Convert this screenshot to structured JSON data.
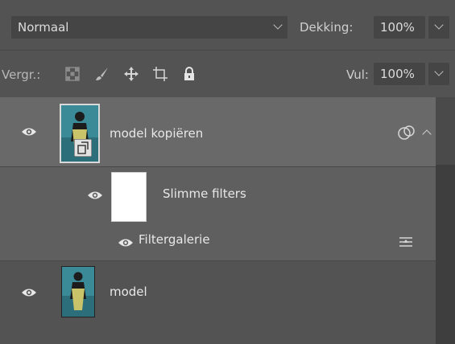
{
  "blend": {
    "mode": "Normaal",
    "opacity_label": "Dekking:",
    "opacity_value": "100%"
  },
  "locks": {
    "label": "Vergr.:",
    "icons": [
      "lock-transparent-pixels-icon",
      "lock-image-pixels-icon",
      "lock-position-icon",
      "lock-artboard-icon",
      "lock-all-icon"
    ],
    "fill_label": "Vul:",
    "fill_value": "100%"
  },
  "layers": [
    {
      "name": "model kopiëren",
      "visible": true,
      "selected": true,
      "smart_object": true,
      "expanded": true
    },
    {
      "name": "Slimme filters",
      "visible": true,
      "type": "smart-filter-mask"
    },
    {
      "name": "Filtergalerie",
      "visible": true,
      "type": "filter"
    },
    {
      "name": "model",
      "visible": true,
      "selected": false
    }
  ],
  "colors": {
    "panel_bg": "#535353",
    "selected_row": "#696969",
    "field_bg": "#454545"
  }
}
